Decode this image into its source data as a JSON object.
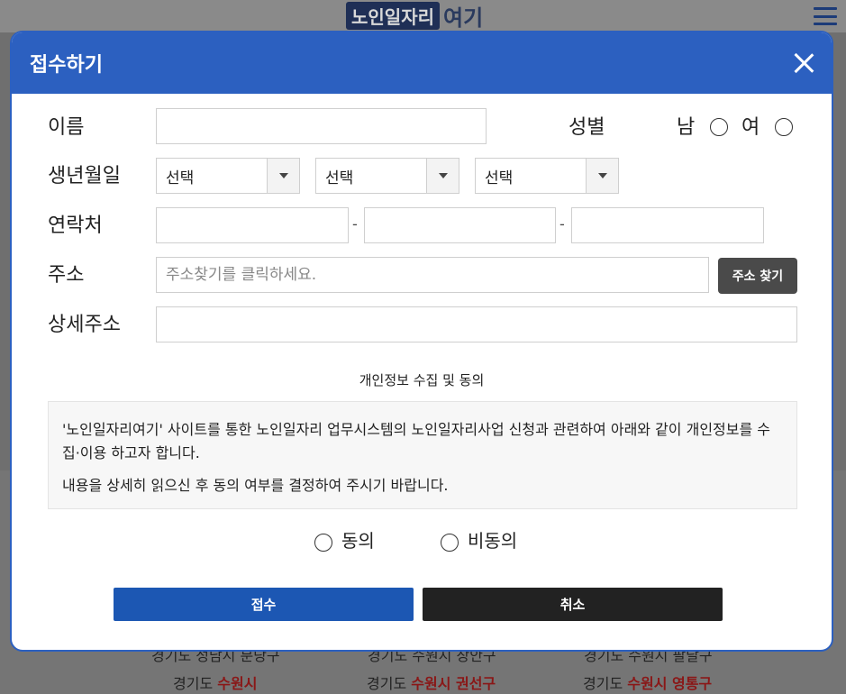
{
  "background": {
    "logo_box": "노인일자리",
    "logo_text": "여기",
    "row_top": [
      "경기도 성남시 분당구",
      "경기도 수원시 장안구",
      "경기도 수원시 팔달구"
    ],
    "row_bottom": [
      {
        "province": "경기도",
        "city": "수원시"
      },
      {
        "province": "경기도",
        "city": "수원시 권선구"
      },
      {
        "province": "경기도",
        "city": "수원시 영통구"
      }
    ]
  },
  "modal": {
    "title": "접수하기",
    "fields": {
      "name_label": "이름",
      "name_value": "",
      "gender_label": "성별",
      "gender_male": "남",
      "gender_female": "여",
      "birth_label": "생년월일",
      "birth_year": "선택",
      "birth_month": "선택",
      "birth_day": "선택",
      "phone_label": "연락처",
      "phone_dash": "-",
      "address_label": "주소",
      "address_placeholder": "주소찾기를 클릭하세요.",
      "address_button": "주소 찾기",
      "detail_label": "상세주소",
      "detail_value": ""
    },
    "privacy": {
      "title": "개인정보 수집 및 동의",
      "paragraph1": "'노인일자리여기' 사이트를 통한 노인일자리 업무시스템의 노인일자리사업 신청과 관련하여 아래와 같이 개인정보를 수집·이용 하고자 합니다.",
      "paragraph2": "내용을 상세히 읽으신 후 동의 여부를 결정하여 주시기 바랍니다.",
      "agree": "동의",
      "disagree": "비동의"
    },
    "buttons": {
      "submit": "접수",
      "cancel": "취소"
    }
  },
  "colors": {
    "header_blue": "#2c60c0",
    "submit_blue": "#1c57b3",
    "cancel_dark": "#222222",
    "address_button": "#4a4a4a"
  }
}
